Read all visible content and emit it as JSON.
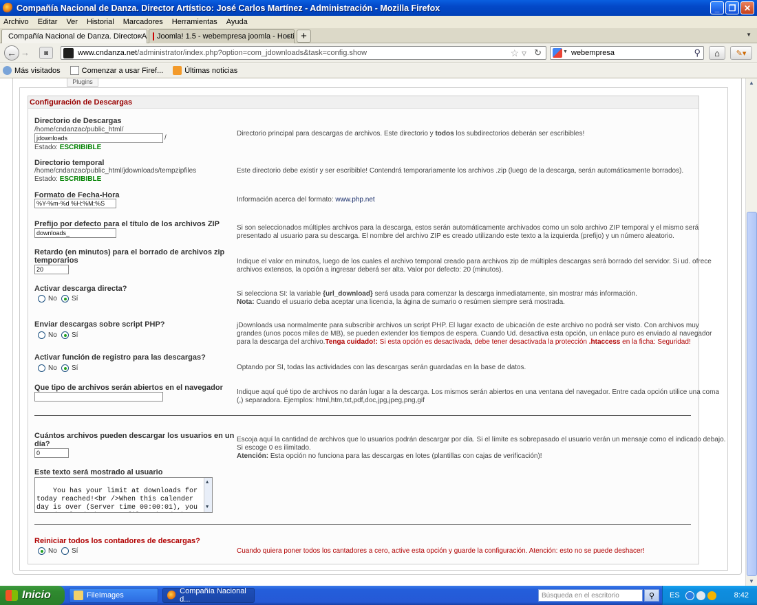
{
  "window": {
    "title": "Compañía Nacional de Danza. Director Artístico: José Carlos Martínez - Administración - Mozilla Firefox",
    "minimize": "_",
    "maximize": "❐",
    "close": "✕"
  },
  "menu": [
    "Archivo",
    "Editar",
    "Ver",
    "Historial",
    "Marcadores",
    "Herramientas",
    "Ayuda"
  ],
  "tabs": [
    {
      "label": "Compañía Nacional de Danza. Director Ar...",
      "close": "✕"
    },
    {
      "label": "Joomla! 1.5 - webempresa joomla - Hosti...",
      "close": "✕"
    }
  ],
  "newtab": "+",
  "nav": {
    "url_domain": "www.cndanza.net",
    "url_path": "/administrator/index.php?option=com_jdownloads&task=config.show",
    "search_value": "webempresa"
  },
  "bookmarks": [
    "Más visitados",
    "Comenzar a usar Firef...",
    "Últimas noticias"
  ],
  "page": {
    "plugins_tab": "Plugins",
    "section_title": "Configuración de Descargas",
    "download_dir": {
      "label": "Directorio de Descargas",
      "path": "/home/cndanzac/public_html/",
      "value": "jdownloads",
      "slash": "/",
      "status_label": "Estado:",
      "status_value": "ESCRIBIBLE",
      "desc_a": "Directorio principal para descargas de archivos. Este directorio y ",
      "desc_b": "todos",
      "desc_c": " los subdirectorios deberán ser escribibles!"
    },
    "temp_dir": {
      "label": "Directorio temporal",
      "path": "/home/cndanzac/public_html/jdownloads/tempzipfiles",
      "status_label": "Estado:",
      "status_value": "ESCRIBIBLE",
      "desc": "Este directorio debe existir y ser escribible! Contendrá temporariamente los archivos .zip (luego de la descarga, serán automáticamente borrados)."
    },
    "date_format": {
      "label": "Formato de Fecha-Hora",
      "value": "%Y-%m-%d %H:%M:%S",
      "desc": "Información acerca del formato: ",
      "link": "www.php.net"
    },
    "zip_prefix": {
      "label": "Prefijo por defecto para el título de los archivos ZIP",
      "value": "downloads_",
      "desc1": "Si son seleccionados múltiples archivos para la descarga, estos serán automáticamente archivados como un solo archivo ZIP temporal y el mismo será",
      "desc2": "presentado al usuario para su descarga. El nombre del archivo ZIP es creado utilizando este texto a la izquierda (prefijo) y un número aleatorio."
    },
    "zip_delay": {
      "label1": "Retardo (en minutos) para el borrado de archivos zip",
      "label2": "temporarios",
      "value": "20",
      "desc1": "Indique el valor en minutos, luego de los cuales el archivo temporal creado para archivos zip de múltiples descargas será borrado del servidor. Si ud. ofrece",
      "desc2": "archivos extensos, la opción a ingresar deberá ser alta. Valor por defecto: 20 (minutos)."
    },
    "direct_download": {
      "label": "Activar descarga directa?",
      "no": "No",
      "yes": "Sí",
      "desc1a": "Si selecciona SI: la variable ",
      "desc1b": "{url_download}",
      "desc1c": " será usada para comenzar la descarga inmediatamente, sin mostrar más información.",
      "desc2a": "Nota:",
      "desc2b": " Cuando el usuario deba aceptar una licencia, la ágina de sumario o resúmen siempre será mostrada."
    },
    "php_script": {
      "label": "Enviar descargas sobre script PHP?",
      "no": "No",
      "yes": "Sí",
      "desc1": "jDownloads usa normalmente para subscribir archivos un script PHP. El lugar exacto de ubicación de este archivo no podrá ser visto. Con archivos muy",
      "desc2": "grandes (unos pocos miles de MB), se pueden extender los tiempos de espera. Cuando Ud. desactiva esta opción, un enlace puro es enviado al navegador",
      "desc3a": "para la descarga del archivo.",
      "desc3b": "Tenga cuidado!:",
      "desc3c": " Si esta opción es desactivada, debe tener desactivada la protección ",
      "desc3d": ".htaccess",
      "desc3e": " en la ficha: Seguridad!"
    },
    "logging": {
      "label": "Activar función de registro para las descargas?",
      "no": "No",
      "yes": "Sí",
      "desc": "Optando por SI, todas las actividades con las descargas serán guardadas en la base de datos."
    },
    "browser_types": {
      "label": "Que tipo de archivos serán abiertos en el navegador",
      "value": "",
      "desc1": "Indique aquí qué tipo de archivos no darán lugar a la descarga. Los mismos serán abiertos en una ventana del navegador. Entre cada opción utilice una coma",
      "desc2": "(,) separadora. Ejemplos: html,htm,txt,pdf,doc,jpg,jpeg,png,gif"
    },
    "daily_limit": {
      "label1": "Cuántos archivos pueden descargar los usuarios en un",
      "label2": "día?",
      "value": "0",
      "desc1": "Escoja aquí la cantidad de archivos que lo usuarios podrán descargar por día. Si el límite es sobrepasado el usuario verán un mensaje como el indicado debajo.",
      "desc2": "Si escoge 0 es ilimitado.",
      "desc3a": "Atención:",
      "desc3b": " Esta opción no funciona para las descargas en lotes (plantillas con cajas de verificación)!"
    },
    "limit_text": {
      "label": "Este texto será mostrado al usuario",
      "value": "You has your limit at downloads for today reached!<br />When this calender day is over (Server time 00:00:01), you can download the next files.<br /><br"
    },
    "reset_counters": {
      "label": "Reiniciar todos los contadores de descargas?",
      "no": "No",
      "yes": "Sí",
      "desc": "Cuando quiera poner todos los cantadores a cero, active esta opción y guarde la configuración. Atención: esto no se puede deshacer!"
    }
  },
  "taskbar": {
    "start": "Inicio",
    "tasks": [
      "FileImages",
      "Compañía Nacional d..."
    ],
    "search_placeholder": "Búsqueda en el escritorio",
    "lang": "ES",
    "clock": "8:42"
  }
}
